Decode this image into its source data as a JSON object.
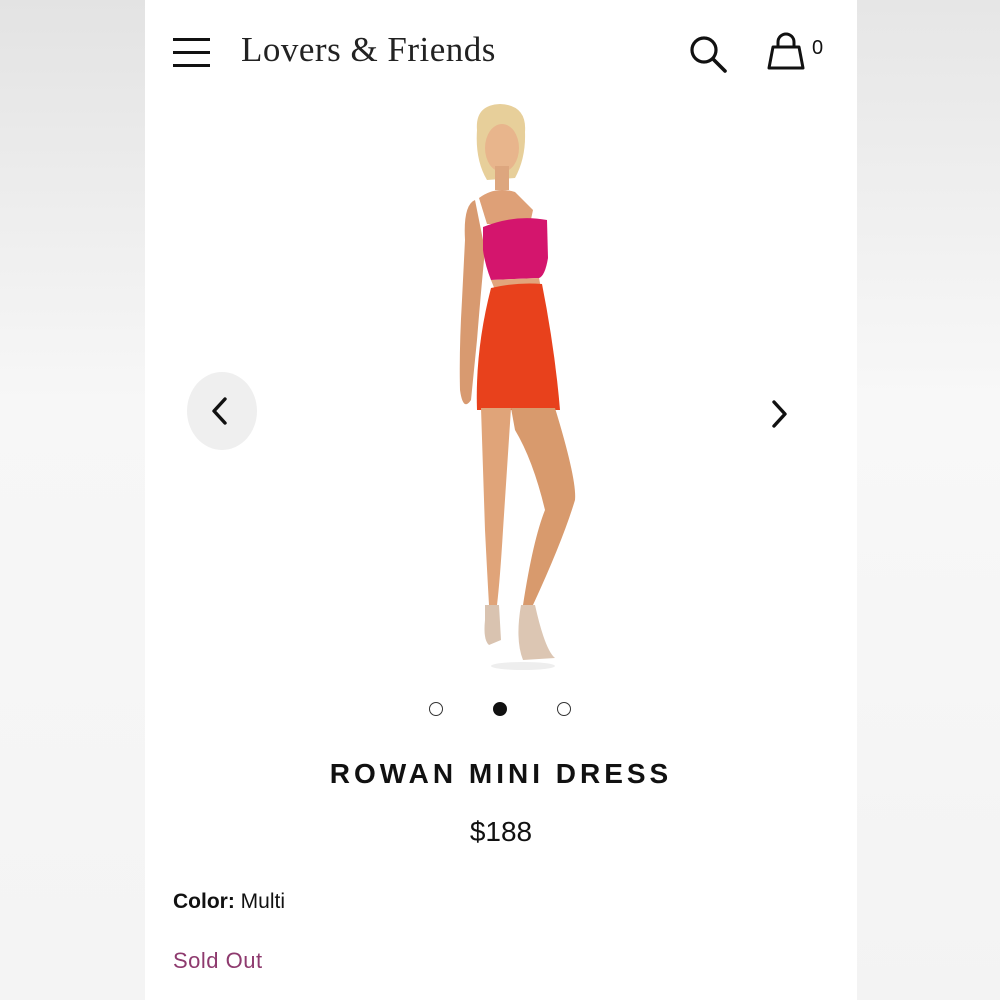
{
  "header": {
    "brand": "Lovers & Friends",
    "bag_count": "0"
  },
  "gallery": {
    "slide_count": 3,
    "active_slide": 2
  },
  "product": {
    "name": "ROWAN MINI DRESS",
    "price": "$188",
    "color_label": "Color:",
    "color_value": "Multi",
    "status": "Sold Out"
  },
  "colors": {
    "status": "#8e3a6e",
    "top": "#d4156d",
    "skirt": "#e8411c"
  },
  "icons": {
    "menu": "hamburger-icon",
    "search": "search-icon",
    "bag": "shopping-bag-icon",
    "prev": "chevron-left-icon",
    "next": "chevron-right-icon"
  }
}
